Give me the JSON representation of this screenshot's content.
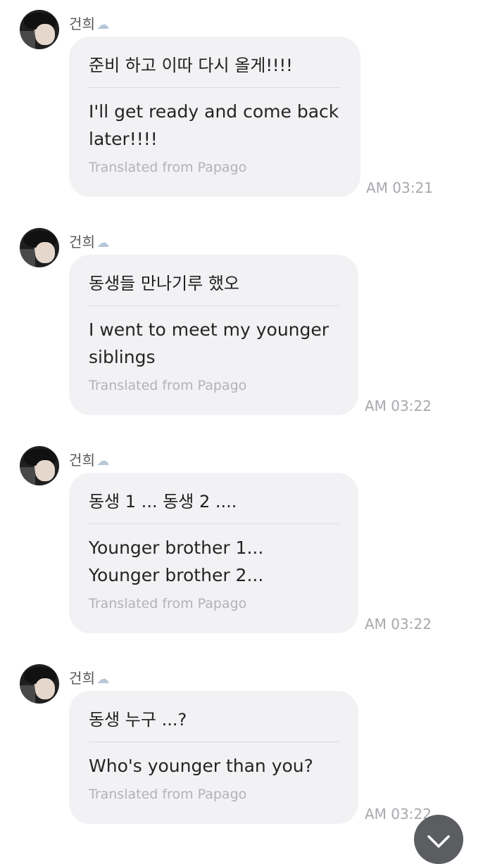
{
  "messages": [
    {
      "sender": "건희",
      "original": "준비 하고 이따 다시 올게!!!!",
      "translated": "I'll get ready and come back later!!!!",
      "source": "Translated from Papago",
      "time": "AM 03:21"
    },
    {
      "sender": "건희",
      "original": "동생들 만나기루 했오",
      "translated": "I went to meet my younger siblings",
      "source": "Translated from Papago",
      "time": "AM 03:22"
    },
    {
      "sender": "건희",
      "original": "동생 1 ... 동생 2 ....",
      "translated": "Younger brother 1... Younger brother 2...",
      "source": "Translated from Papago",
      "time": "AM 03:22"
    },
    {
      "sender": "건희",
      "original": "동생 누구 ...?",
      "translated": "Who's younger than you?",
      "source": "Translated from Papago",
      "time": "AM 03:22"
    }
  ],
  "icons": {
    "sender_badge": "cloud-icon",
    "scroll_down": "chevron-down-icon"
  },
  "colors": {
    "bubble": "#f2f2f4",
    "secondary_text": "#b2b2b8",
    "scroll_button": "#5b5d61"
  }
}
